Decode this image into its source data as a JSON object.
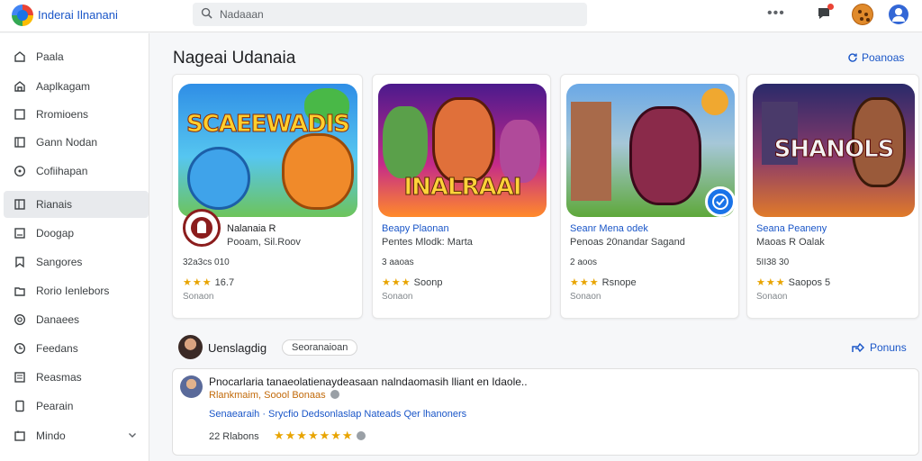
{
  "header": {
    "app_title": "Inderai Ilnanani",
    "search_placeholder": "Nadaaan",
    "menu_dots": "•••",
    "icons": [
      "app-logo",
      "search-icon",
      "more-dots-icon",
      "notifications-icon",
      "cookie-icon",
      "account-icon"
    ]
  },
  "sidebar": {
    "items": [
      {
        "label": "Paala",
        "icon": "home-icon"
      },
      {
        "label": "Aaplkagam",
        "icon": "apps-icon"
      },
      {
        "label": "Rromioens",
        "icon": "square-icon"
      },
      {
        "label": "Gann Nodan",
        "icon": "book-icon"
      },
      {
        "label": "Cofiihapan",
        "icon": "compass-icon"
      },
      {
        "label": "Rianais",
        "icon": "columns-icon"
      },
      {
        "label": "Doogap",
        "icon": "tablet-icon"
      },
      {
        "label": "Sangores",
        "icon": "bookmark-icon"
      },
      {
        "label": "Rorio Ienlebors",
        "icon": "folder-icon"
      },
      {
        "label": "Danaees",
        "icon": "target-icon"
      },
      {
        "label": "Feedans",
        "icon": "clock-icon"
      },
      {
        "label": "Reasmas",
        "icon": "list-icon"
      },
      {
        "label": "Pearain",
        "icon": "phone-icon"
      },
      {
        "label": "Mindo",
        "icon": "calendar-icon"
      }
    ],
    "active_index": 5
  },
  "main": {
    "title": "Nageai Udanaia",
    "see_more": "Poanoas",
    "cards": [
      {
        "game_text": "SCAEEWADIS",
        "title": "Nalanaia R",
        "title_color": "#202124",
        "subtitle": "Pooam, Sil.Roov",
        "meta": "32a3cs 010",
        "rating": "16.7",
        "stars": "★★★",
        "footer": "Sonaon"
      },
      {
        "game_text": "INALRAAI",
        "title": "Beapy Plaonan",
        "title_color": "#1a56c8",
        "subtitle": "Pentes Mlodk: Marta",
        "meta": "3 aaoas",
        "rating": "Soonp",
        "stars": "★★★",
        "footer": "Sonaon"
      },
      {
        "game_text": "",
        "title": "Seanr Mena odek",
        "title_color": "#1a56c8",
        "subtitle": "Penoas 20nandar Sagand",
        "meta": "2 aoos",
        "rating": "Rsnope",
        "stars": "★★★",
        "footer": "Sonaon"
      },
      {
        "game_text": "SHANOLS",
        "title": "Seana Peaneny",
        "title_color": "#1a56c8",
        "subtitle": "Maoas R Oalak",
        "meta": "5II38 30",
        "rating": "Saopos 5",
        "stars": "★★★",
        "footer": "Sonaon"
      }
    ]
  },
  "reviews": {
    "title": "Uenslagdig",
    "chip": "Seoranaioan",
    "link": "Ponuns",
    "item": {
      "text": "Pnocarlaria tanaeolatienaydeasaan nalndaomasih lliant en Idaole..",
      "author": "Rlankmaim, Soool Bonaas",
      "link": "Senaearaih · Srycfio Dedsonlaslap Nateads Qer lhanoners",
      "date": "22 Rlabons",
      "stars": "★★★★★★★"
    }
  },
  "colors": {
    "accent": "#1a56c8",
    "star": "#e8a400",
    "active_nav": "#e8eaed"
  }
}
